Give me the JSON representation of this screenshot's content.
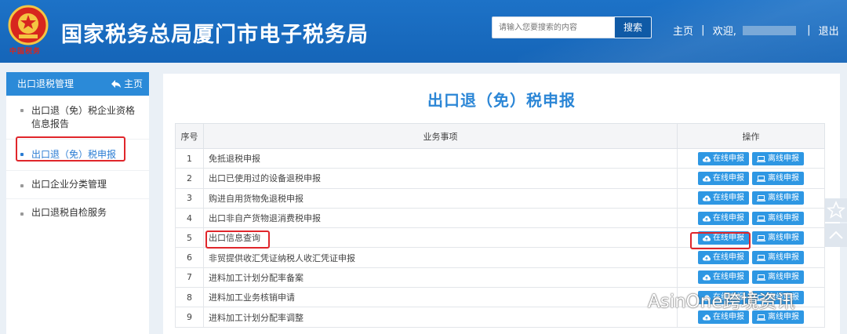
{
  "header": {
    "title": "国家税务总局厦门市电子税务局",
    "emblem_text": "中国税务",
    "search_placeholder": "请输入您要搜索的内容",
    "search_button": "搜索",
    "nav_home": "主页",
    "nav_welcome": "欢迎,",
    "nav_logout": "退出"
  },
  "sidebar": {
    "header": "出口退税管理",
    "home_link": "主页",
    "items": [
      {
        "label": "出口退（免）税企业资格信息报告"
      },
      {
        "label": "出口退（免）税申报"
      },
      {
        "label": "出口企业分类管理"
      },
      {
        "label": "出口退税自检服务"
      }
    ]
  },
  "main": {
    "title": "出口退（免）税申报",
    "columns": [
      "序号",
      "业务事项",
      "操作"
    ],
    "online_label": "在线申报",
    "offline_label": "离线申报",
    "rows": [
      {
        "no": "1",
        "item": "免抵退税申报"
      },
      {
        "no": "2",
        "item": "出口已使用过的设备退税申报"
      },
      {
        "no": "3",
        "item": "购进自用货物免退税申报"
      },
      {
        "no": "4",
        "item": "出口非自产货物退消费税申报"
      },
      {
        "no": "5",
        "item": "出口信息查询"
      },
      {
        "no": "6",
        "item": "非贸提供收汇凭证纳税人收汇凭证申报"
      },
      {
        "no": "7",
        "item": "进料加工计划分配率备案"
      },
      {
        "no": "8",
        "item": "进料加工业务核销申请"
      },
      {
        "no": "9",
        "item": "进料加工计划分配率调整"
      }
    ]
  },
  "watermark": "AsinOne跨境资讯",
  "colors": {
    "header_bg": "#1565b8",
    "accent": "#2b86d6",
    "button": "#2e97e3",
    "highlight": "#e0262b"
  }
}
